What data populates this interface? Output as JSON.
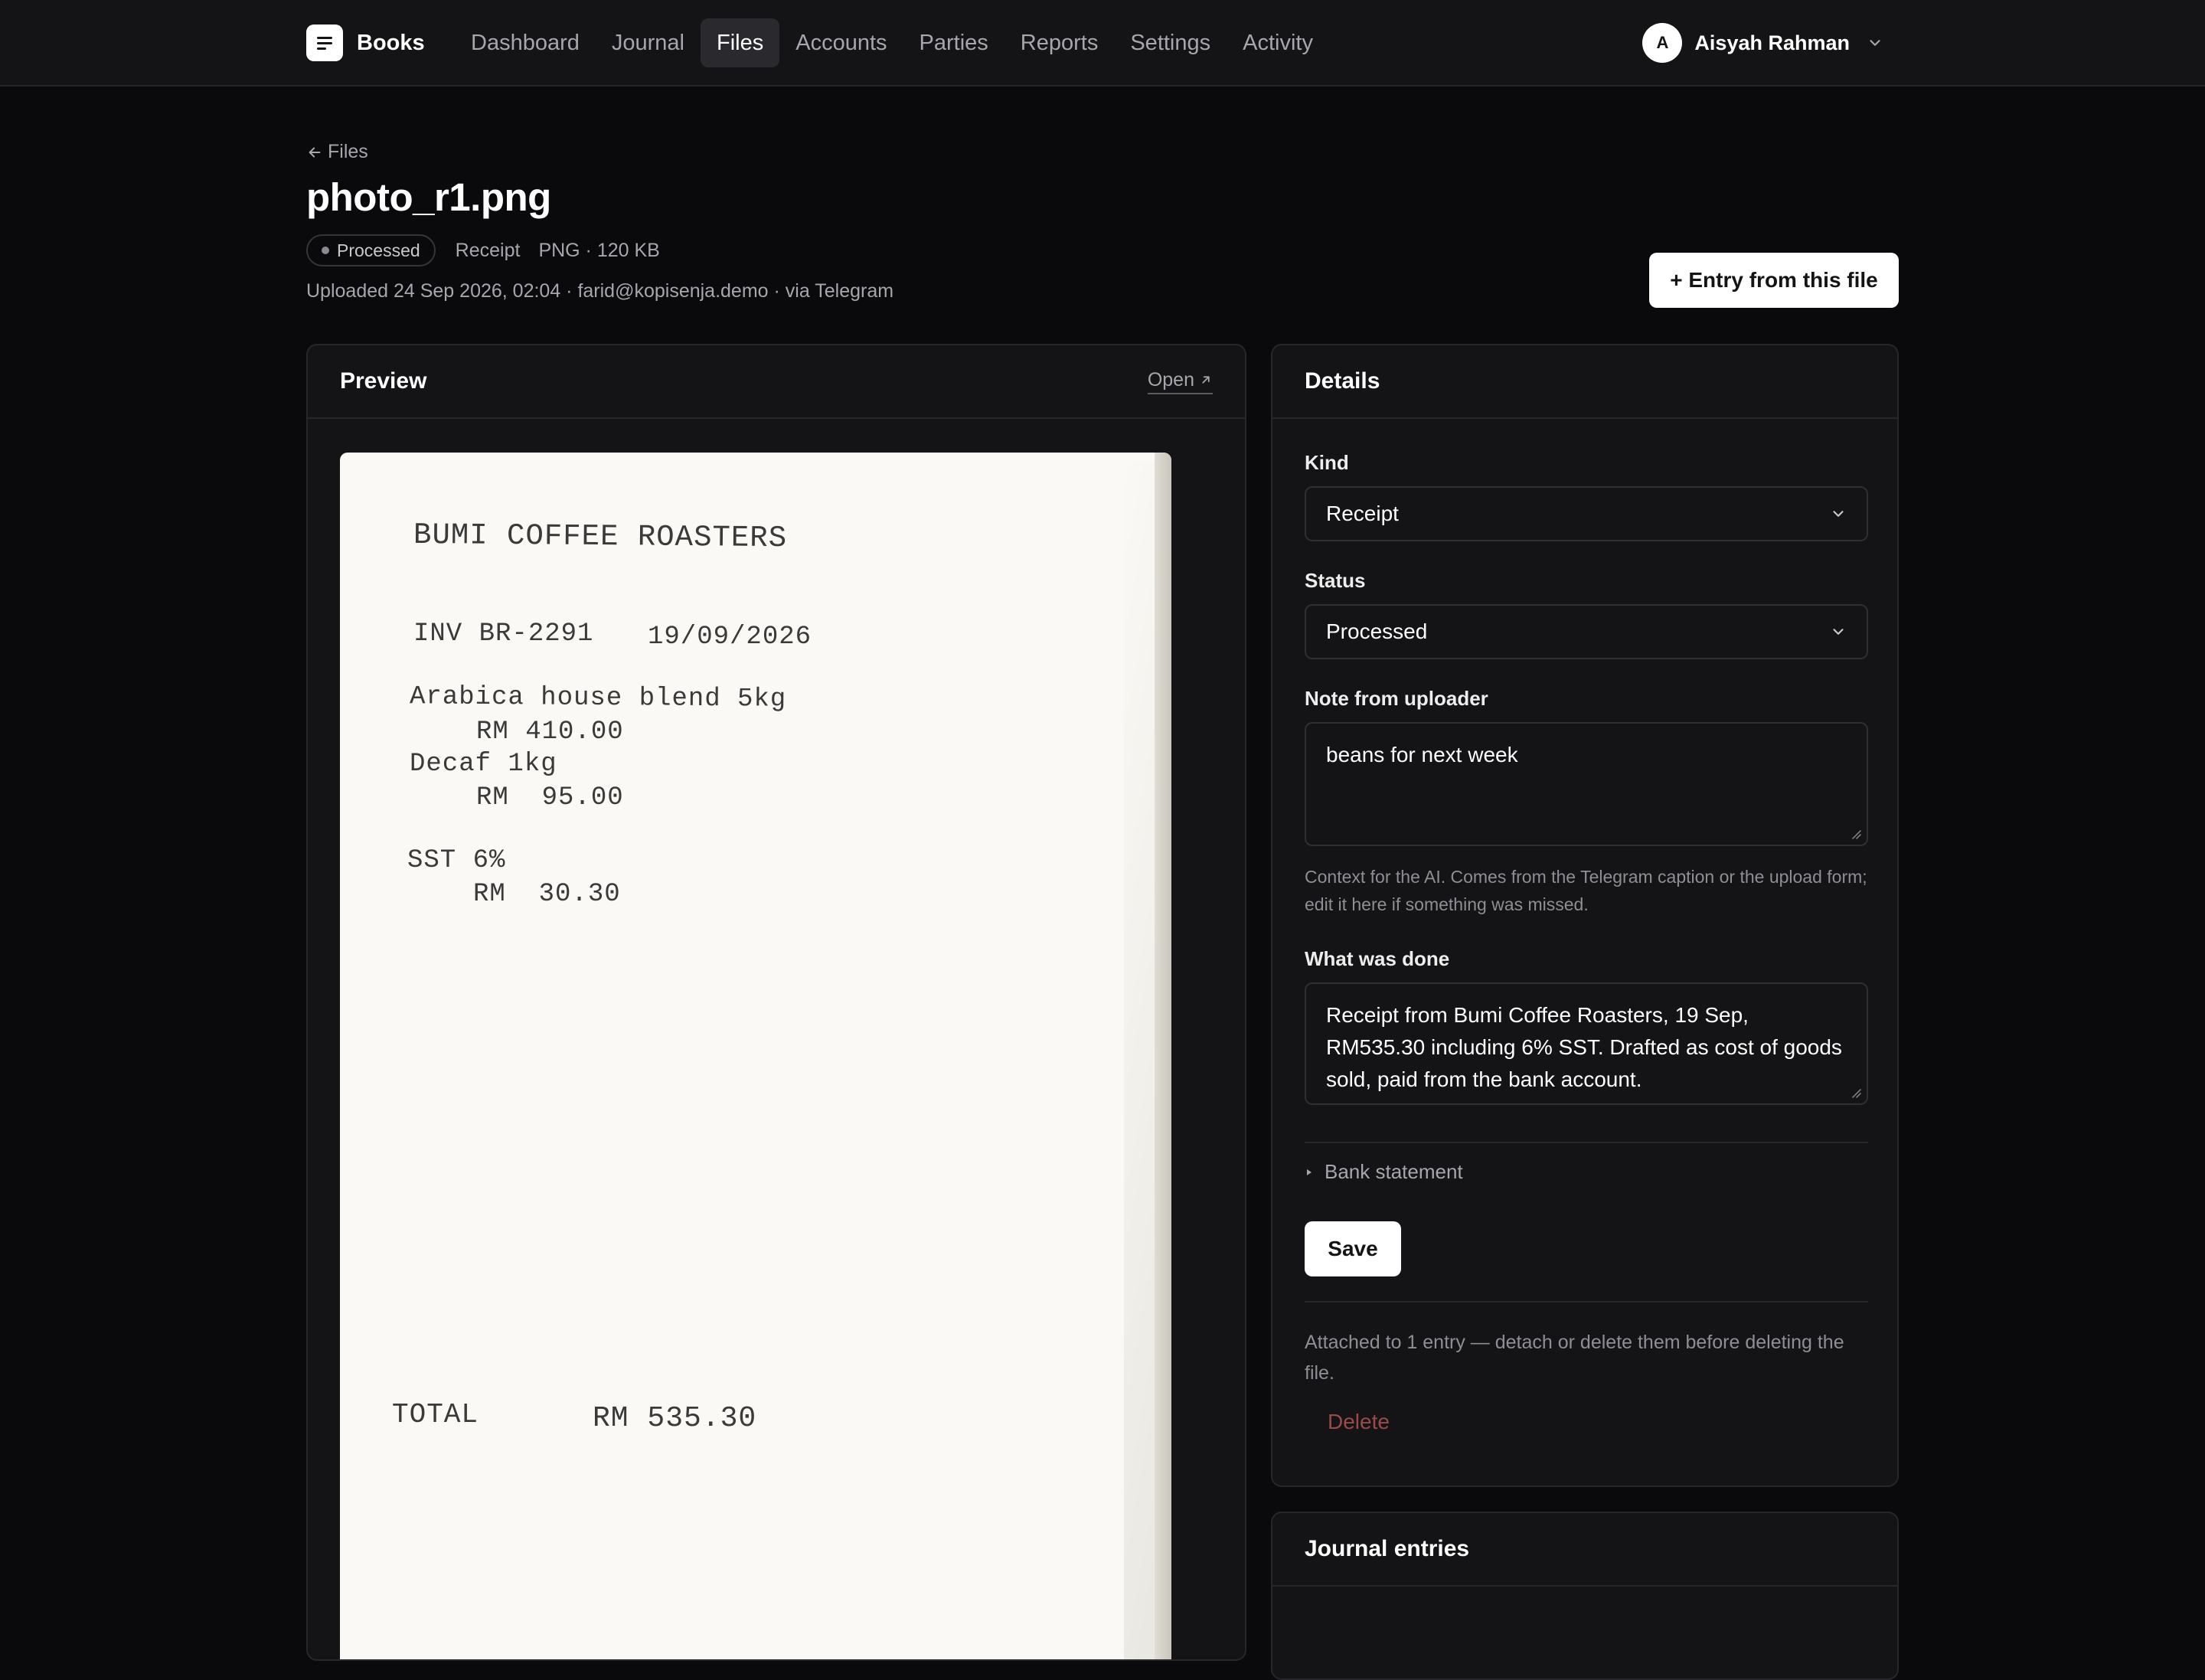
{
  "app": {
    "name": "Books"
  },
  "nav": {
    "items": [
      {
        "label": "Dashboard",
        "active": false
      },
      {
        "label": "Journal",
        "active": false
      },
      {
        "label": "Files",
        "active": true
      },
      {
        "label": "Accounts",
        "active": false
      },
      {
        "label": "Parties",
        "active": false
      },
      {
        "label": "Reports",
        "active": false
      },
      {
        "label": "Settings",
        "active": false
      },
      {
        "label": "Activity",
        "active": false
      }
    ]
  },
  "user": {
    "initial": "A",
    "name": "Aisyah Rahman"
  },
  "header": {
    "back_label": "Files",
    "title": "photo_r1.png",
    "status_badge": "Processed",
    "kind": "Receipt",
    "file_info": "PNG · 120 KB",
    "uploaded": "Uploaded 24 Sep 2026, 02:04 · farid@kopisenja.demo · via Telegram",
    "primary_action": "+ Entry from this file"
  },
  "preview": {
    "title": "Preview",
    "open_label": "Open",
    "receipt": {
      "store": "BUMI COFFEE ROASTERS",
      "invoice": "INV BR-2291",
      "date": "19/09/2026",
      "line1_desc": "Arabica house blend 5kg",
      "line1_amt": "RM 410.00",
      "line2_desc": "Decaf 1kg",
      "line2_amt": "RM  95.00",
      "tax_desc": "SST 6%",
      "tax_amt": "RM  30.30",
      "total_label": "TOTAL",
      "total_amt": "RM 535.30"
    }
  },
  "details": {
    "title": "Details",
    "kind_label": "Kind",
    "kind_value": "Receipt",
    "status_label": "Status",
    "status_value": "Processed",
    "note_label": "Note from uploader",
    "note_value": "beans for next week",
    "note_help": "Context for the AI. Comes from the Telegram caption or the upload form; edit it here if something was missed.",
    "done_label": "What was done",
    "done_value": "Receipt from Bumi Coffee Roasters, 19 Sep, RM535.30 including 6% SST. Drafted as cost of goods sold, paid from the bank account.",
    "bank_statement_label": "Bank statement",
    "save_label": "Save",
    "attached_text": "Attached to 1 entry — detach or delete them before deleting the file.",
    "delete_label": "Delete"
  },
  "journal": {
    "title": "Journal entries"
  },
  "colors": {
    "background": "#0a0a0c",
    "card": "#141416",
    "border": "#26262b",
    "danger": "#9a4a48"
  }
}
